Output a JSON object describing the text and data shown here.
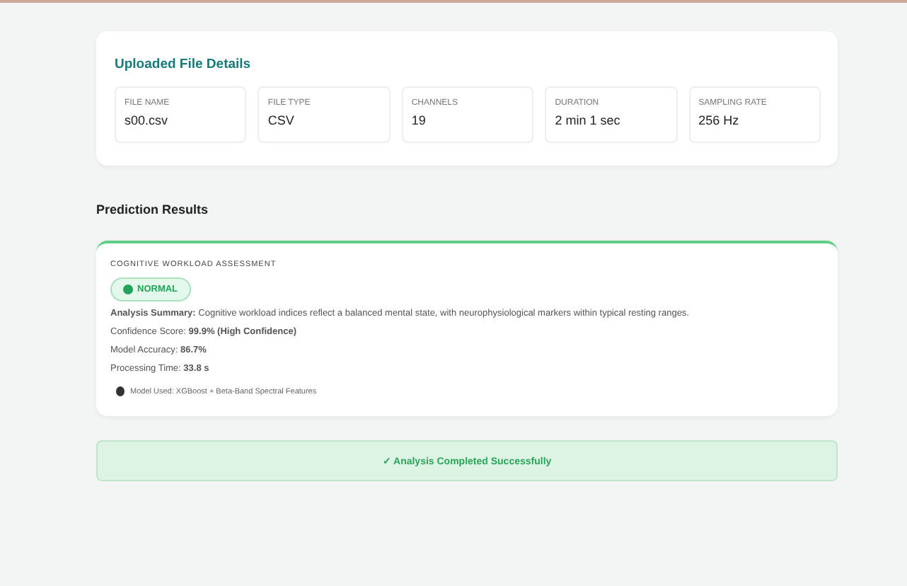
{
  "file_details": {
    "title": "Uploaded File Details",
    "fields": [
      {
        "label": "FILE NAME",
        "value": "s00.csv"
      },
      {
        "label": "FILE TYPE",
        "value": "CSV"
      },
      {
        "label": "CHANNELS",
        "value": "19"
      },
      {
        "label": "DURATION",
        "value": "2 min 1 sec"
      },
      {
        "label": "SAMPLING RATE",
        "value": "256 Hz"
      }
    ]
  },
  "prediction": {
    "title": "Prediction Results",
    "heading": "COGNITIVE WORKLOAD ASSESSMENT",
    "status": {
      "label": "NORMAL",
      "kind": "normal"
    },
    "lines": [
      "**Analysis Summary:** Cognitive workload indices reflect a balanced mental state, with neurophysiological markers within typical resting ranges.",
      "Confidence Score: **99.9% (High Confidence)**",
      "Model Accuracy: **86.7%**",
      "Processing Time: **33.8 s**"
    ],
    "model_used": "Model Used: XGBoost + Beta-Band Spectral Features"
  },
  "banner": {
    "text": "✓ Analysis Completed Successfully"
  }
}
